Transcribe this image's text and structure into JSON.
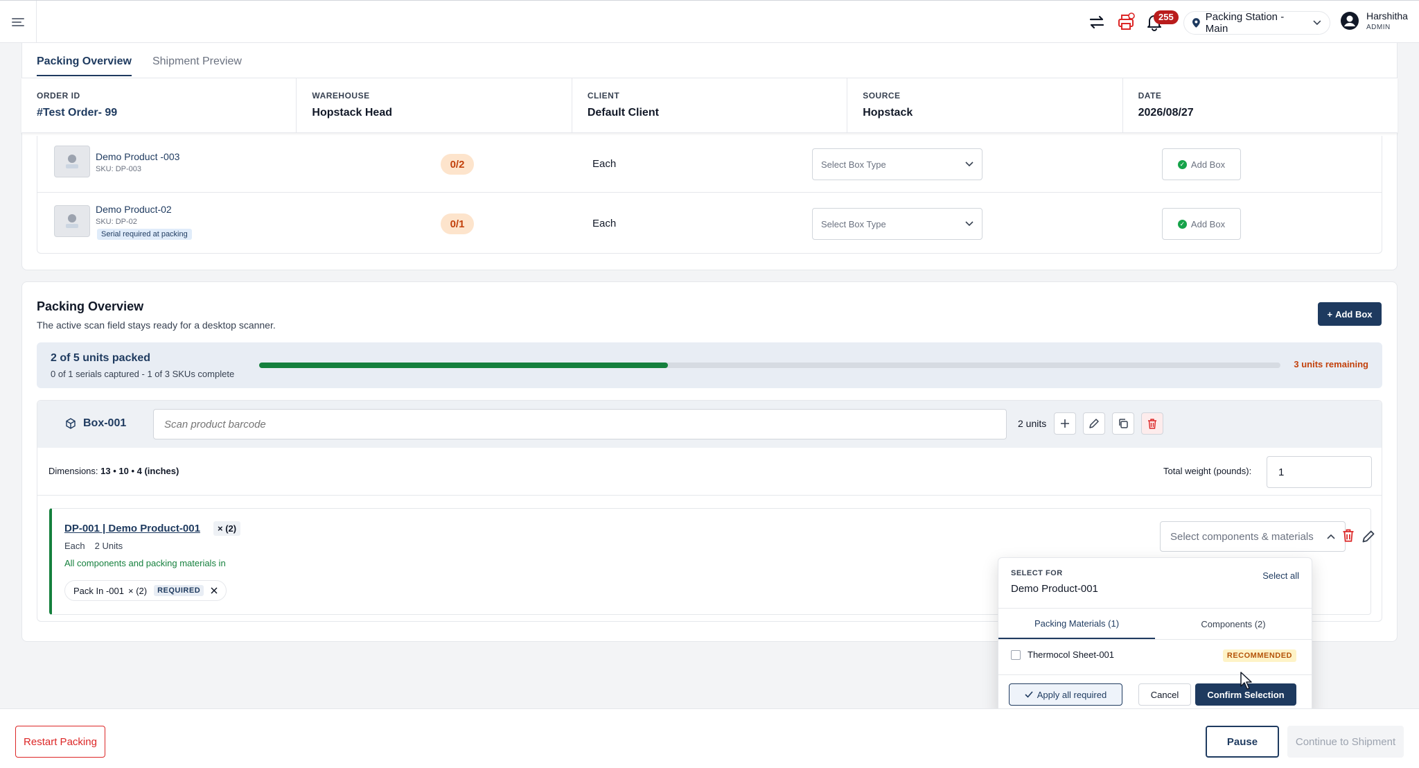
{
  "topbar": {
    "notification_count": "255",
    "station": "Packing Station - Main",
    "user_name": "Harshitha",
    "user_role": "ADMIN"
  },
  "tabs": [
    {
      "label": "Packing Overview",
      "active": true
    },
    {
      "label": "Shipment Preview",
      "active": false
    }
  ],
  "order_info": {
    "order_id_label": "ORDER ID",
    "order_id": "#Test Order- 99",
    "warehouse_label": "WAREHOUSE",
    "warehouse": "Hopstack Head",
    "client_label": "CLIENT",
    "client": "Default Client",
    "source_label": "SOURCE",
    "source": "Hopstack",
    "date_label": "DATE",
    "date": "2026/08/27"
  },
  "products": [
    {
      "name": "Demo Product -003",
      "sku": "SKU: DP-003",
      "qty": "0/2",
      "uom": "Each",
      "box_placeholder": "Select Box Type",
      "add_label": "Add Box",
      "tag": ""
    },
    {
      "name": "Demo Product-02",
      "sku": "SKU: DP-02",
      "qty": "0/1",
      "uom": "Each",
      "box_placeholder": "Select Box Type",
      "add_label": "Add Box",
      "tag": "Serial required at packing"
    }
  ],
  "packing_overview": {
    "title": "Packing Overview",
    "subtitle": "The active scan field stays ready for a desktop scanner.",
    "add_box_label": "Add Box",
    "progress_title": "2 of 5 units packed",
    "progress_sub": "0 of 1 serials captured - 1 of 3 SKUs complete",
    "progress_value": 0.4,
    "remaining": "3 units remaining"
  },
  "box": {
    "name": "Box-001",
    "scan_placeholder": "Scan product barcode",
    "units": "2 units",
    "dims_label": "Dimensions:",
    "dims_value": "13 • 10 • 4 (inches)",
    "weight_label": "Total weight (pounds):",
    "weight_value": "1"
  },
  "item": {
    "title": "DP-001 | Demo Product-001",
    "multiplier": "× (2)",
    "uom": "Each",
    "units": "2 Units",
    "status": "All components and packing materials in",
    "chip_name": "Pack In -001",
    "chip_qty": "× (2)",
    "chip_tag": "REQUIRED",
    "select_placeholder": "Select components & materials"
  },
  "popover": {
    "label": "SELECT FOR",
    "product": "Demo Product-001",
    "select_all": "Select all",
    "tab_materials": "Packing Materials (1)",
    "tab_components": "Components (2)",
    "item_name": "Thermocol Sheet-001",
    "item_tag": "RECOMMENDED",
    "apply_label": "Apply all required",
    "cancel_label": "Cancel",
    "confirm_label": "Confirm Selection"
  },
  "footer": {
    "restart_label": "Restart Packing",
    "pause_label": "Pause",
    "continue_label": "Continue to Shipment"
  },
  "colors": {
    "primary": "#1e3a5f",
    "success": "#15803d",
    "danger": "#dc2626",
    "warning": "#c2410c"
  }
}
